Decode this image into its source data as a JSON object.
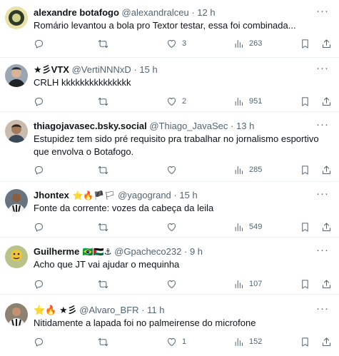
{
  "tweets": [
    {
      "name": "alexandre botafogo",
      "badges": "",
      "handle": "@alexandralceu",
      "dot": "·",
      "time": "12 h",
      "text": "Romário levantou a bola pro Textor testar, essa foi combinada...",
      "replies": "",
      "retweets": "",
      "likes": "3",
      "views": "263",
      "avatar_bg": "#e8e2a8"
    },
    {
      "name": "★彡VTX",
      "badges": "",
      "handle": "@VertiNNNxD",
      "dot": "·",
      "time": "15 h",
      "text": "CRLH kkkkkkkkkkkkkkk",
      "replies": "",
      "retweets": "",
      "likes": "2",
      "views": "951",
      "avatar_bg": "#7d8a97"
    },
    {
      "name": "thiagojavasec.bsky.social",
      "badges": "",
      "handle": "@Thiago_JavaSec",
      "dot": "·",
      "time": "13 h",
      "text": "Estupidez tem sido pré requisito pra trabalhar no jornalismo esportivo que envolva o Botafogo.",
      "replies": "",
      "retweets": "",
      "likes": "",
      "views": "285",
      "avatar_bg": "#b8a898"
    },
    {
      "name": "Jhontex",
      "badges": "⭐🔥🏴🏳",
      "handle": "@yagogrand",
      "dot": "·",
      "time": "15 h",
      "text": "Fonte da corrente: vozes da cabeça da leila",
      "replies": "",
      "retweets": "",
      "likes": "",
      "views": "549",
      "avatar_bg": "#55606a"
    },
    {
      "name": "Guilherme",
      "badges": "🇧🇷🇵🇸⚓",
      "handle": "@Gpacheco232",
      "dot": "·",
      "time": "9 h",
      "text": "Acho que JT  vai ajudar o mequinha",
      "replies": "",
      "retweets": "",
      "likes": "",
      "views": "107",
      "avatar_bg": "#a8b37a"
    },
    {
      "name": "⭐🔥 ★彡",
      "badges": "",
      "handle": "@Alvaro_BFR",
      "dot": "·",
      "time": "11 h",
      "text": "Nitidamente a lapada foi no palmeirense do microfone",
      "replies": "",
      "retweets": "",
      "likes": "1",
      "views": "152",
      "avatar_bg": "#8a7e6c"
    }
  ],
  "icons": {
    "reply": "reply-icon",
    "retweet": "retweet-icon",
    "like": "heart-icon",
    "views": "views-icon",
    "bookmark": "bookmark-icon",
    "share": "share-icon",
    "more": "more-icon"
  },
  "more_label": "···"
}
